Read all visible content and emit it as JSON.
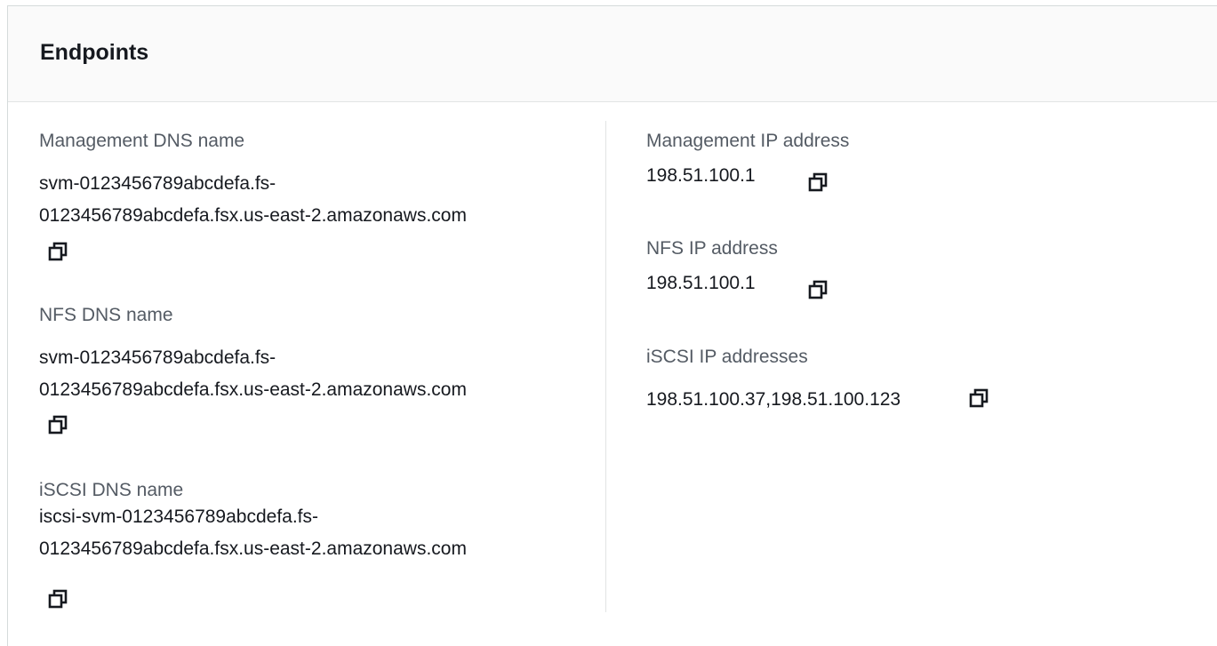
{
  "panel": {
    "title": "Endpoints"
  },
  "left": {
    "management_dns": {
      "label": "Management DNS name",
      "line1": "svm-0123456789abcdefa.fs-",
      "line2": "0123456789abcdefa.fsx.us-east-2.amazonaws.com"
    },
    "nfs_dns": {
      "label": "NFS DNS name",
      "line1": "svm-0123456789abcdefa.fs-",
      "line2": "0123456789abcdefa.fsx.us-east-2.amazonaws.com"
    },
    "iscsi_dns": {
      "label": "iSCSI DNS name",
      "line1": "iscsi-svm-0123456789abcdefa.fs-",
      "line2": "0123456789abcdefa.fsx.us-east-2.amazonaws.com"
    }
  },
  "right": {
    "management_ip": {
      "label": "Management IP address",
      "value": "198.51.100.1"
    },
    "nfs_ip": {
      "label": "NFS IP address",
      "value": "198.51.100.1"
    },
    "iscsi_ip": {
      "label": "iSCSI IP addresses",
      "value": "198.51.100.37,198.51.100.123"
    }
  },
  "icons": {
    "copy": "copy-icon"
  },
  "colors": {
    "label": "#545b64",
    "value": "#16191f",
    "header_bg": "#fafafa",
    "border": "#e2e4e4"
  }
}
